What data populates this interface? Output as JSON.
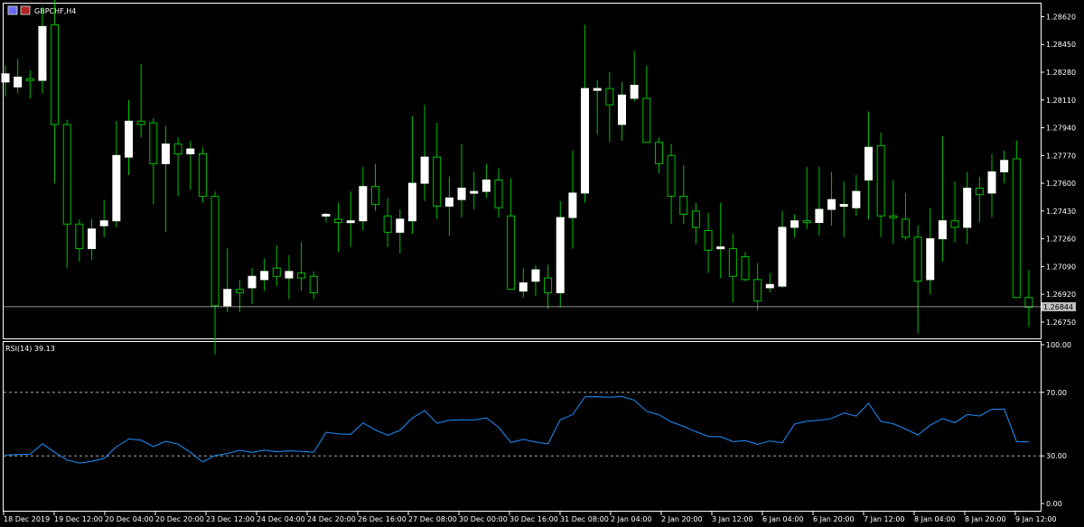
{
  "window": {
    "title": "GBPCHF,H4",
    "colors": {
      "background": "#000000",
      "frame": "#ffffff",
      "bull_body": "#ffffff",
      "bear_body": "#000000",
      "wick": "#00c000",
      "rsi_line": "#1e90ff",
      "bid_line": "#bfbfbf",
      "level_line": "#c0c0c0",
      "price_tag_bg": "#c0c0c0",
      "price_tag_text": "#000000"
    }
  },
  "price_axis": {
    "ticks": [
      "1.28620",
      "1.28450",
      "1.28280",
      "1.28110",
      "1.27940",
      "1.27770",
      "1.27600",
      "1.27430",
      "1.27260",
      "1.27090",
      "1.26920",
      "1.26750"
    ],
    "current_price": "1.26844"
  },
  "indicator": {
    "label": "RSI(14) 39.13",
    "ticks": [
      "100.00",
      "70.00",
      "30.00",
      "0.00"
    ]
  },
  "time_axis": {
    "labels": [
      "18 Dec 2019",
      "19 Dec 12:00",
      "20 Dec 04:00",
      "20 Dec 20:00",
      "23 Dec 12:00",
      "24 Dec 04:00",
      "24 Dec 20:00",
      "26 Dec 16:00",
      "27 Dec 08:00",
      "30 Dec 00:00",
      "30 Dec 16:00",
      "31 Dec 08:00",
      "2 Jan 04:00",
      "2 Jan 20:00",
      "3 Jan 12:00",
      "6 Jan 04:00",
      "6 Jan 20:00",
      "7 Jan 12:00",
      "8 Jan 04:00",
      "8 Jan 20:00",
      "9 Jan 12:00"
    ]
  },
  "chart_data": [
    {
      "type": "candlestick",
      "symbol": "GBPCHF",
      "timeframe": "H4",
      "ylim": [
        1.2665,
        1.287
      ],
      "candles": [
        {
          "o": 1.2822,
          "h": 1.2832,
          "l": 1.2813,
          "c": 1.2827
        },
        {
          "o": 1.2819,
          "h": 1.2836,
          "l": 1.2815,
          "c": 1.2825
        },
        {
          "o": 1.2824,
          "h": 1.2829,
          "l": 1.2812,
          "c": 1.2823
        },
        {
          "o": 1.2823,
          "h": 1.2868,
          "l": 1.2815,
          "c": 1.2856
        },
        {
          "o": 1.2857,
          "h": 1.2878,
          "l": 1.276,
          "c": 1.2796
        },
        {
          "o": 1.2796,
          "h": 1.2799,
          "l": 1.2708,
          "c": 1.2735
        },
        {
          "o": 1.2735,
          "h": 1.2738,
          "l": 1.2712,
          "c": 1.272
        },
        {
          "o": 1.272,
          "h": 1.2738,
          "l": 1.2713,
          "c": 1.2732
        },
        {
          "o": 1.2734,
          "h": 1.275,
          "l": 1.2727,
          "c": 1.2737
        },
        {
          "o": 1.2737,
          "h": 1.2798,
          "l": 1.2733,
          "c": 1.2777
        },
        {
          "o": 1.2776,
          "h": 1.2811,
          "l": 1.2765,
          "c": 1.2798
        },
        {
          "o": 1.2798,
          "h": 1.2833,
          "l": 1.2788,
          "c": 1.2796
        },
        {
          "o": 1.2797,
          "h": 1.28,
          "l": 1.2747,
          "c": 1.2772
        },
        {
          "o": 1.2772,
          "h": 1.2795,
          "l": 1.273,
          "c": 1.2784
        },
        {
          "o": 1.2784,
          "h": 1.2788,
          "l": 1.2752,
          "c": 1.2778
        },
        {
          "o": 1.2778,
          "h": 1.2786,
          "l": 1.2756,
          "c": 1.2781
        },
        {
          "o": 1.2778,
          "h": 1.2782,
          "l": 1.2748,
          "c": 1.2752
        },
        {
          "o": 1.2752,
          "h": 1.2755,
          "l": 1.2655,
          "c": 1.2685
        },
        {
          "o": 1.2685,
          "h": 1.272,
          "l": 1.2681,
          "c": 1.2695
        },
        {
          "o": 1.2695,
          "h": 1.2701,
          "l": 1.2681,
          "c": 1.2693
        },
        {
          "o": 1.2696,
          "h": 1.2708,
          "l": 1.2686,
          "c": 1.2703
        },
        {
          "o": 1.2701,
          "h": 1.2714,
          "l": 1.2694,
          "c": 1.2706
        },
        {
          "o": 1.2708,
          "h": 1.2722,
          "l": 1.2697,
          "c": 1.2703
        },
        {
          "o": 1.2702,
          "h": 1.2716,
          "l": 1.2689,
          "c": 1.2706
        },
        {
          "o": 1.2705,
          "h": 1.2724,
          "l": 1.2694,
          "c": 1.2702
        },
        {
          "o": 1.2703,
          "h": 1.2706,
          "l": 1.2689,
          "c": 1.2693
        },
        {
          "o": 1.274,
          "h": 1.2742,
          "l": 1.2736,
          "c": 1.2741
        },
        {
          "o": 1.2738,
          "h": 1.2748,
          "l": 1.2718,
          "c": 1.2736
        },
        {
          "o": 1.2736,
          "h": 1.2755,
          "l": 1.2721,
          "c": 1.2737
        },
        {
          "o": 1.2737,
          "h": 1.277,
          "l": 1.2731,
          "c": 1.2758
        },
        {
          "o": 1.2758,
          "h": 1.2772,
          "l": 1.2743,
          "c": 1.2747
        },
        {
          "o": 1.274,
          "h": 1.2751,
          "l": 1.2721,
          "c": 1.273
        },
        {
          "o": 1.273,
          "h": 1.2744,
          "l": 1.2717,
          "c": 1.2738
        },
        {
          "o": 1.2737,
          "h": 1.2801,
          "l": 1.2729,
          "c": 1.276
        },
        {
          "o": 1.276,
          "h": 1.2808,
          "l": 1.2749,
          "c": 1.2776
        },
        {
          "o": 1.2776,
          "h": 1.2797,
          "l": 1.2738,
          "c": 1.2746
        },
        {
          "o": 1.2746,
          "h": 1.2764,
          "l": 1.2728,
          "c": 1.2751
        },
        {
          "o": 1.275,
          "h": 1.2784,
          "l": 1.2739,
          "c": 1.2757
        },
        {
          "o": 1.2755,
          "h": 1.2767,
          "l": 1.2744,
          "c": 1.2755
        },
        {
          "o": 1.2755,
          "h": 1.2772,
          "l": 1.2751,
          "c": 1.2762
        },
        {
          "o": 1.2762,
          "h": 1.2769,
          "l": 1.2739,
          "c": 1.2745
        },
        {
          "o": 1.274,
          "h": 1.2763,
          "l": 1.2695,
          "c": 1.2695
        },
        {
          "o": 1.2694,
          "h": 1.2708,
          "l": 1.269,
          "c": 1.2699
        },
        {
          "o": 1.27,
          "h": 1.271,
          "l": 1.2691,
          "c": 1.2707
        },
        {
          "o": 1.2702,
          "h": 1.271,
          "l": 1.2683,
          "c": 1.2693
        },
        {
          "o": 1.2693,
          "h": 1.2749,
          "l": 1.2684,
          "c": 1.2739
        },
        {
          "o": 1.2739,
          "h": 1.278,
          "l": 1.272,
          "c": 1.2754
        },
        {
          "o": 1.2754,
          "h": 1.2857,
          "l": 1.2748,
          "c": 1.2818
        },
        {
          "o": 1.2818,
          "h": 1.2823,
          "l": 1.279,
          "c": 1.2818
        },
        {
          "o": 1.2818,
          "h": 1.2828,
          "l": 1.2785,
          "c": 1.2808
        },
        {
          "o": 1.2796,
          "h": 1.2822,
          "l": 1.2786,
          "c": 1.2814
        },
        {
          "o": 1.2812,
          "h": 1.2841,
          "l": 1.281,
          "c": 1.282
        },
        {
          "o": 1.2812,
          "h": 1.2832,
          "l": 1.2786,
          "c": 1.2785
        },
        {
          "o": 1.2785,
          "h": 1.2788,
          "l": 1.2766,
          "c": 1.2772
        },
        {
          "o": 1.2777,
          "h": 1.2784,
          "l": 1.2735,
          "c": 1.2752
        },
        {
          "o": 1.2752,
          "h": 1.2771,
          "l": 1.2735,
          "c": 1.2741
        },
        {
          "o": 1.2743,
          "h": 1.2748,
          "l": 1.2723,
          "c": 1.2733
        },
        {
          "o": 1.2731,
          "h": 1.2742,
          "l": 1.2705,
          "c": 1.2719
        },
        {
          "o": 1.272,
          "h": 1.2748,
          "l": 1.2702,
          "c": 1.2721
        },
        {
          "o": 1.272,
          "h": 1.2729,
          "l": 1.2687,
          "c": 1.2703
        },
        {
          "o": 1.2715,
          "h": 1.2718,
          "l": 1.27,
          "c": 1.2701
        },
        {
          "o": 1.2701,
          "h": 1.2711,
          "l": 1.2682,
          "c": 1.2688
        },
        {
          "o": 1.2696,
          "h": 1.2705,
          "l": 1.2693,
          "c": 1.2698
        },
        {
          "o": 1.2697,
          "h": 1.2743,
          "l": 1.2696,
          "c": 1.2733
        },
        {
          "o": 1.2733,
          "h": 1.2741,
          "l": 1.2727,
          "c": 1.2737
        },
        {
          "o": 1.2737,
          "h": 1.277,
          "l": 1.2732,
          "c": 1.2736
        },
        {
          "o": 1.2736,
          "h": 1.277,
          "l": 1.2728,
          "c": 1.2744
        },
        {
          "o": 1.2744,
          "h": 1.2767,
          "l": 1.2734,
          "c": 1.275
        },
        {
          "o": 1.2747,
          "h": 1.2761,
          "l": 1.2727,
          "c": 1.2747
        },
        {
          "o": 1.2745,
          "h": 1.2765,
          "l": 1.274,
          "c": 1.2755
        },
        {
          "o": 1.2762,
          "h": 1.2804,
          "l": 1.2738,
          "c": 1.2782
        },
        {
          "o": 1.2783,
          "h": 1.2791,
          "l": 1.2727,
          "c": 1.274
        },
        {
          "o": 1.274,
          "h": 1.2762,
          "l": 1.2723,
          "c": 1.2739
        },
        {
          "o": 1.2738,
          "h": 1.2754,
          "l": 1.2725,
          "c": 1.2727
        },
        {
          "o": 1.2727,
          "h": 1.2734,
          "l": 1.2668,
          "c": 1.27
        },
        {
          "o": 1.2701,
          "h": 1.2745,
          "l": 1.2692,
          "c": 1.2726
        },
        {
          "o": 1.2726,
          "h": 1.2789,
          "l": 1.2712,
          "c": 1.2737
        },
        {
          "o": 1.2737,
          "h": 1.2761,
          "l": 1.2724,
          "c": 1.2733
        },
        {
          "o": 1.2733,
          "h": 1.2767,
          "l": 1.2723,
          "c": 1.2757
        },
        {
          "o": 1.2757,
          "h": 1.2764,
          "l": 1.2736,
          "c": 1.2753
        },
        {
          "o": 1.2754,
          "h": 1.2778,
          "l": 1.2739,
          "c": 1.2767
        },
        {
          "o": 1.2767,
          "h": 1.278,
          "l": 1.276,
          "c": 1.2774
        },
        {
          "o": 1.2775,
          "h": 1.2786,
          "l": 1.271,
          "c": 1.269
        },
        {
          "o": 1.269,
          "h": 1.2707,
          "l": 1.2672,
          "c": 1.2684
        }
      ]
    },
    {
      "type": "line",
      "name": "RSI(14)",
      "ylim": [
        0,
        100
      ],
      "values": [
        30.5,
        30.8,
        31.0,
        37.6,
        32.2,
        27.4,
        25.5,
        26.6,
        28.4,
        35.8,
        40.6,
        39.9,
        35.9,
        39.2,
        37.4,
        32.2,
        26.2,
        30.2,
        31.5,
        33.5,
        32.3,
        33.6,
        32.6,
        33.2,
        32.9,
        32.3,
        44.9,
        43.8,
        43.6,
        50.8,
        46.3,
        43.0,
        46.1,
        53.8,
        58.5,
        50.5,
        52.4,
        52.8,
        52.6,
        54.0,
        48.0,
        38.4,
        40.4,
        38.7,
        37.5,
        52.8,
        56.0,
        67.2,
        67.3,
        66.9,
        67.4,
        65.1,
        58.1,
        55.9,
        51.4,
        48.6,
        45.2,
        42.3,
        42.1,
        38.9,
        39.6,
        37.3,
        39.4,
        38.3,
        50.1,
        51.9,
        52.4,
        53.6,
        57.0,
        55.0,
        63.1,
        51.7,
        50.3,
        46.9,
        43.2,
        49.3,
        53.5,
        50.9,
        56.1,
        55.1,
        59.3,
        59.5,
        39.1,
        38.8
      ]
    }
  ]
}
